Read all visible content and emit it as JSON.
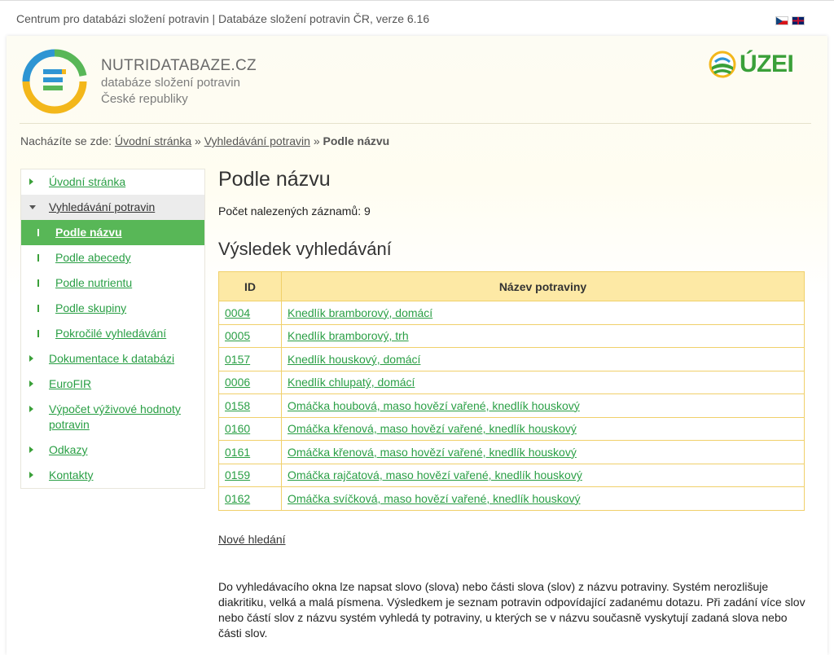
{
  "site_title": "Centrum pro databázi složení potravin | Databáze složení potravin ČR, verze 6.16",
  "colors": {
    "brand_green": "#3aa039",
    "link_green": "#2a9f45",
    "table_header": "#fde9a5",
    "table_border": "#f0d06a",
    "active_nav": "#58b757"
  },
  "header": {
    "brand_name": "NUTRIDATABAZE.CZ",
    "brand_line1": "databáze složení potravin",
    "brand_line2": "České republiky",
    "partner_logo": "ÚZEI"
  },
  "breadcrumb": {
    "prefix": "Nacházíte se zde:",
    "items": [
      "Úvodní stránka",
      "Vyhledávání potravin"
    ],
    "separator": "»",
    "current": "Podle názvu"
  },
  "sidebar": {
    "items": [
      {
        "label": "Úvodní stránka"
      },
      {
        "label": "Vyhledávání potravin",
        "expanded": true
      },
      {
        "label": "Podle názvu",
        "sub": true,
        "active": true
      },
      {
        "label": "Podle abecedy",
        "sub": true
      },
      {
        "label": "Podle nutrientu",
        "sub": true
      },
      {
        "label": "Podle skupiny",
        "sub": true
      },
      {
        "label": "Pokročilé vyhledávání",
        "sub": true
      },
      {
        "label": "Dokumentace k databázi"
      },
      {
        "label": "EuroFIR"
      },
      {
        "label": "Výpočet výživové hodnoty potravin"
      },
      {
        "label": "Odkazy"
      },
      {
        "label": "Kontakty"
      }
    ]
  },
  "main": {
    "title": "Podle názvu",
    "count_text": "Počet nalezených záznamů: 9",
    "results_title": "Výsledek vyhledávání",
    "table": {
      "headers": [
        "ID",
        "Název potraviny"
      ],
      "rows": [
        [
          "0004",
          "Knedlík bramborový, domácí"
        ],
        [
          "0005",
          "Knedlík bramborový, trh"
        ],
        [
          "0157",
          "Knedlík houskový, domácí"
        ],
        [
          "0006",
          "Knedlík chlupatý, domácí"
        ],
        [
          "0158",
          "Omáčka houbová, maso hovězí vařené, knedlík houskový"
        ],
        [
          "0160",
          "Omáčka křenová, maso hovězí vařené, knedlík houskový"
        ],
        [
          "0161",
          "Omáčka křenová, maso hovězí vařené, knedlík houskový"
        ],
        [
          "0159",
          "Omáčka rajčatová, maso hovězí vařené, knedlík houskový"
        ],
        [
          "0162",
          "Omáčka svíčková, maso hovězí vařené, knedlík houskový"
        ]
      ]
    },
    "new_search_label": "Nové hledání",
    "help_text": "Do vyhledávacího okna lze napsat slovo (slova) nebo části slova (slov) z názvu potraviny. Systém nerozlišuje diakritiku, velká a malá písmena. Výsledkem je seznam potravin odpovídající zadanému dotazu. Při zadání více slov nebo částí slov z názvu systém vyhledá ty potraviny, u kterých se v názvu současně vyskytují zadaná slova nebo části slov."
  }
}
